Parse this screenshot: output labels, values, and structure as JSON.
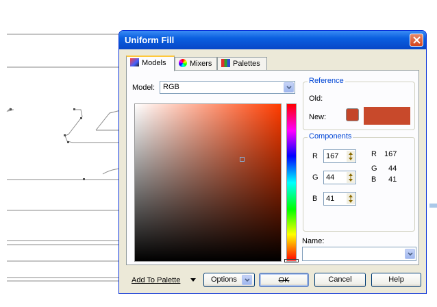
{
  "dialog": {
    "title": "Uniform Fill",
    "close_icon": "close-icon"
  },
  "tabs": [
    {
      "label": "Models",
      "icon": "models-icon",
      "active": true
    },
    {
      "label": "Mixers",
      "icon": "mixers-icon",
      "active": false
    },
    {
      "label": "Palettes",
      "icon": "palettes-icon",
      "active": false
    }
  ],
  "model": {
    "label": "Model:",
    "value": "RGB"
  },
  "reference": {
    "title": "Reference",
    "old_label": "Old:",
    "new_label": "New:",
    "new_color": "#a72c29"
  },
  "components": {
    "title": "Components",
    "fields": [
      {
        "label": "R",
        "value": "167"
      },
      {
        "label": "G",
        "value": "44"
      },
      {
        "label": "B",
        "value": "41"
      }
    ],
    "readout": [
      {
        "label": "R",
        "value": "167"
      },
      {
        "label": "G",
        "value": "44"
      },
      {
        "label": "B",
        "value": "41"
      }
    ]
  },
  "name": {
    "label": "Name:",
    "value": ""
  },
  "buttons": {
    "add_to_palette": "Add To Palette",
    "options": "Options",
    "ok": "OK",
    "cancel": "Cancel",
    "help": "Help"
  },
  "colors": {
    "title_bar": "#0a5fe0",
    "dialog_bg": "#ece9d8",
    "group_title": "#0046d5",
    "hue_base": "#ff3c00"
  }
}
